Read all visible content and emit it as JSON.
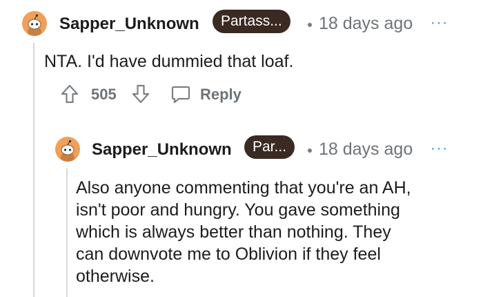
{
  "comments": [
    {
      "username": "Sapper_Unknown",
      "flair": "Partass...",
      "age": "18 days ago",
      "more": "···",
      "body": "NTA. I'd have dummied that loaf.",
      "votes": "505",
      "reply_label": "Reply"
    },
    {
      "username": "Sapper_Unknown",
      "flair": "Par...",
      "age": "18 days ago",
      "more": "···",
      "body_lines": [
        "Also anyone commenting that you're an AH,",
        "isn't poor and hungry. You gave something",
        "which is always better than nothing. They",
        "can downvote me to Oblivion if they feel",
        "otherwise."
      ]
    }
  ],
  "icons": {
    "avatar": "snoo-avatar-icon",
    "upvote": "upvote-arrow-icon",
    "downvote": "downvote-arrow-icon",
    "reply": "comment-bubble-icon",
    "more": "more-options-icon"
  },
  "colors": {
    "flair_bg": "#3a2a22",
    "avatar_bg": "#f0a05a",
    "meta_text": "#6e7377",
    "more_dots": "#2f7fc4"
  }
}
